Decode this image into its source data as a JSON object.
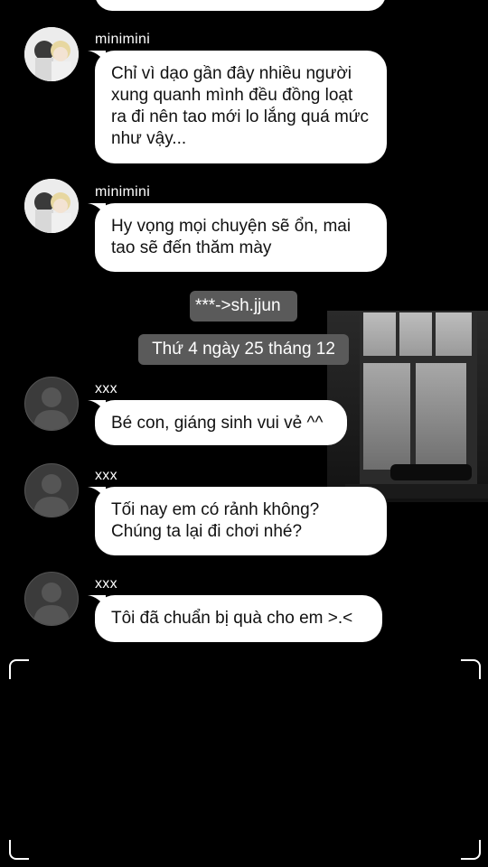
{
  "messages": [
    {
      "id": "m0",
      "sender": "",
      "text": ""
    },
    {
      "id": "m1",
      "sender": "minimini",
      "text": "Chỉ vì dạo gần đây nhiều người xung quanh mình đều đồng loạt ra đi nên tao mới lo lắng quá mức như vậy..."
    },
    {
      "id": "m2",
      "sender": "minimini",
      "text": "Hy vọng mọi chuyện sẽ ổn, mai tao sẽ đến thăm mày"
    },
    {
      "id": "m3",
      "sender": "xxx",
      "text": "Bé con, giáng sinh vui vẻ ^^"
    },
    {
      "id": "m4",
      "sender": "xxx",
      "text": "Tối nay em có rảnh không? Chúng ta lại đi chơi nhé?"
    },
    {
      "id": "m5",
      "sender": "xxx",
      "text": "Tôi đã chuẩn bị quà cho em >.<"
    }
  ],
  "system": {
    "switch_label": "***->sh.jjun",
    "date_label": "Thứ 4 ngày 25 tháng 12"
  },
  "colors": {
    "background": "#000000",
    "bubble": "#ffffff",
    "system_pill": "#5a5a5a",
    "username": "#ffffff"
  }
}
